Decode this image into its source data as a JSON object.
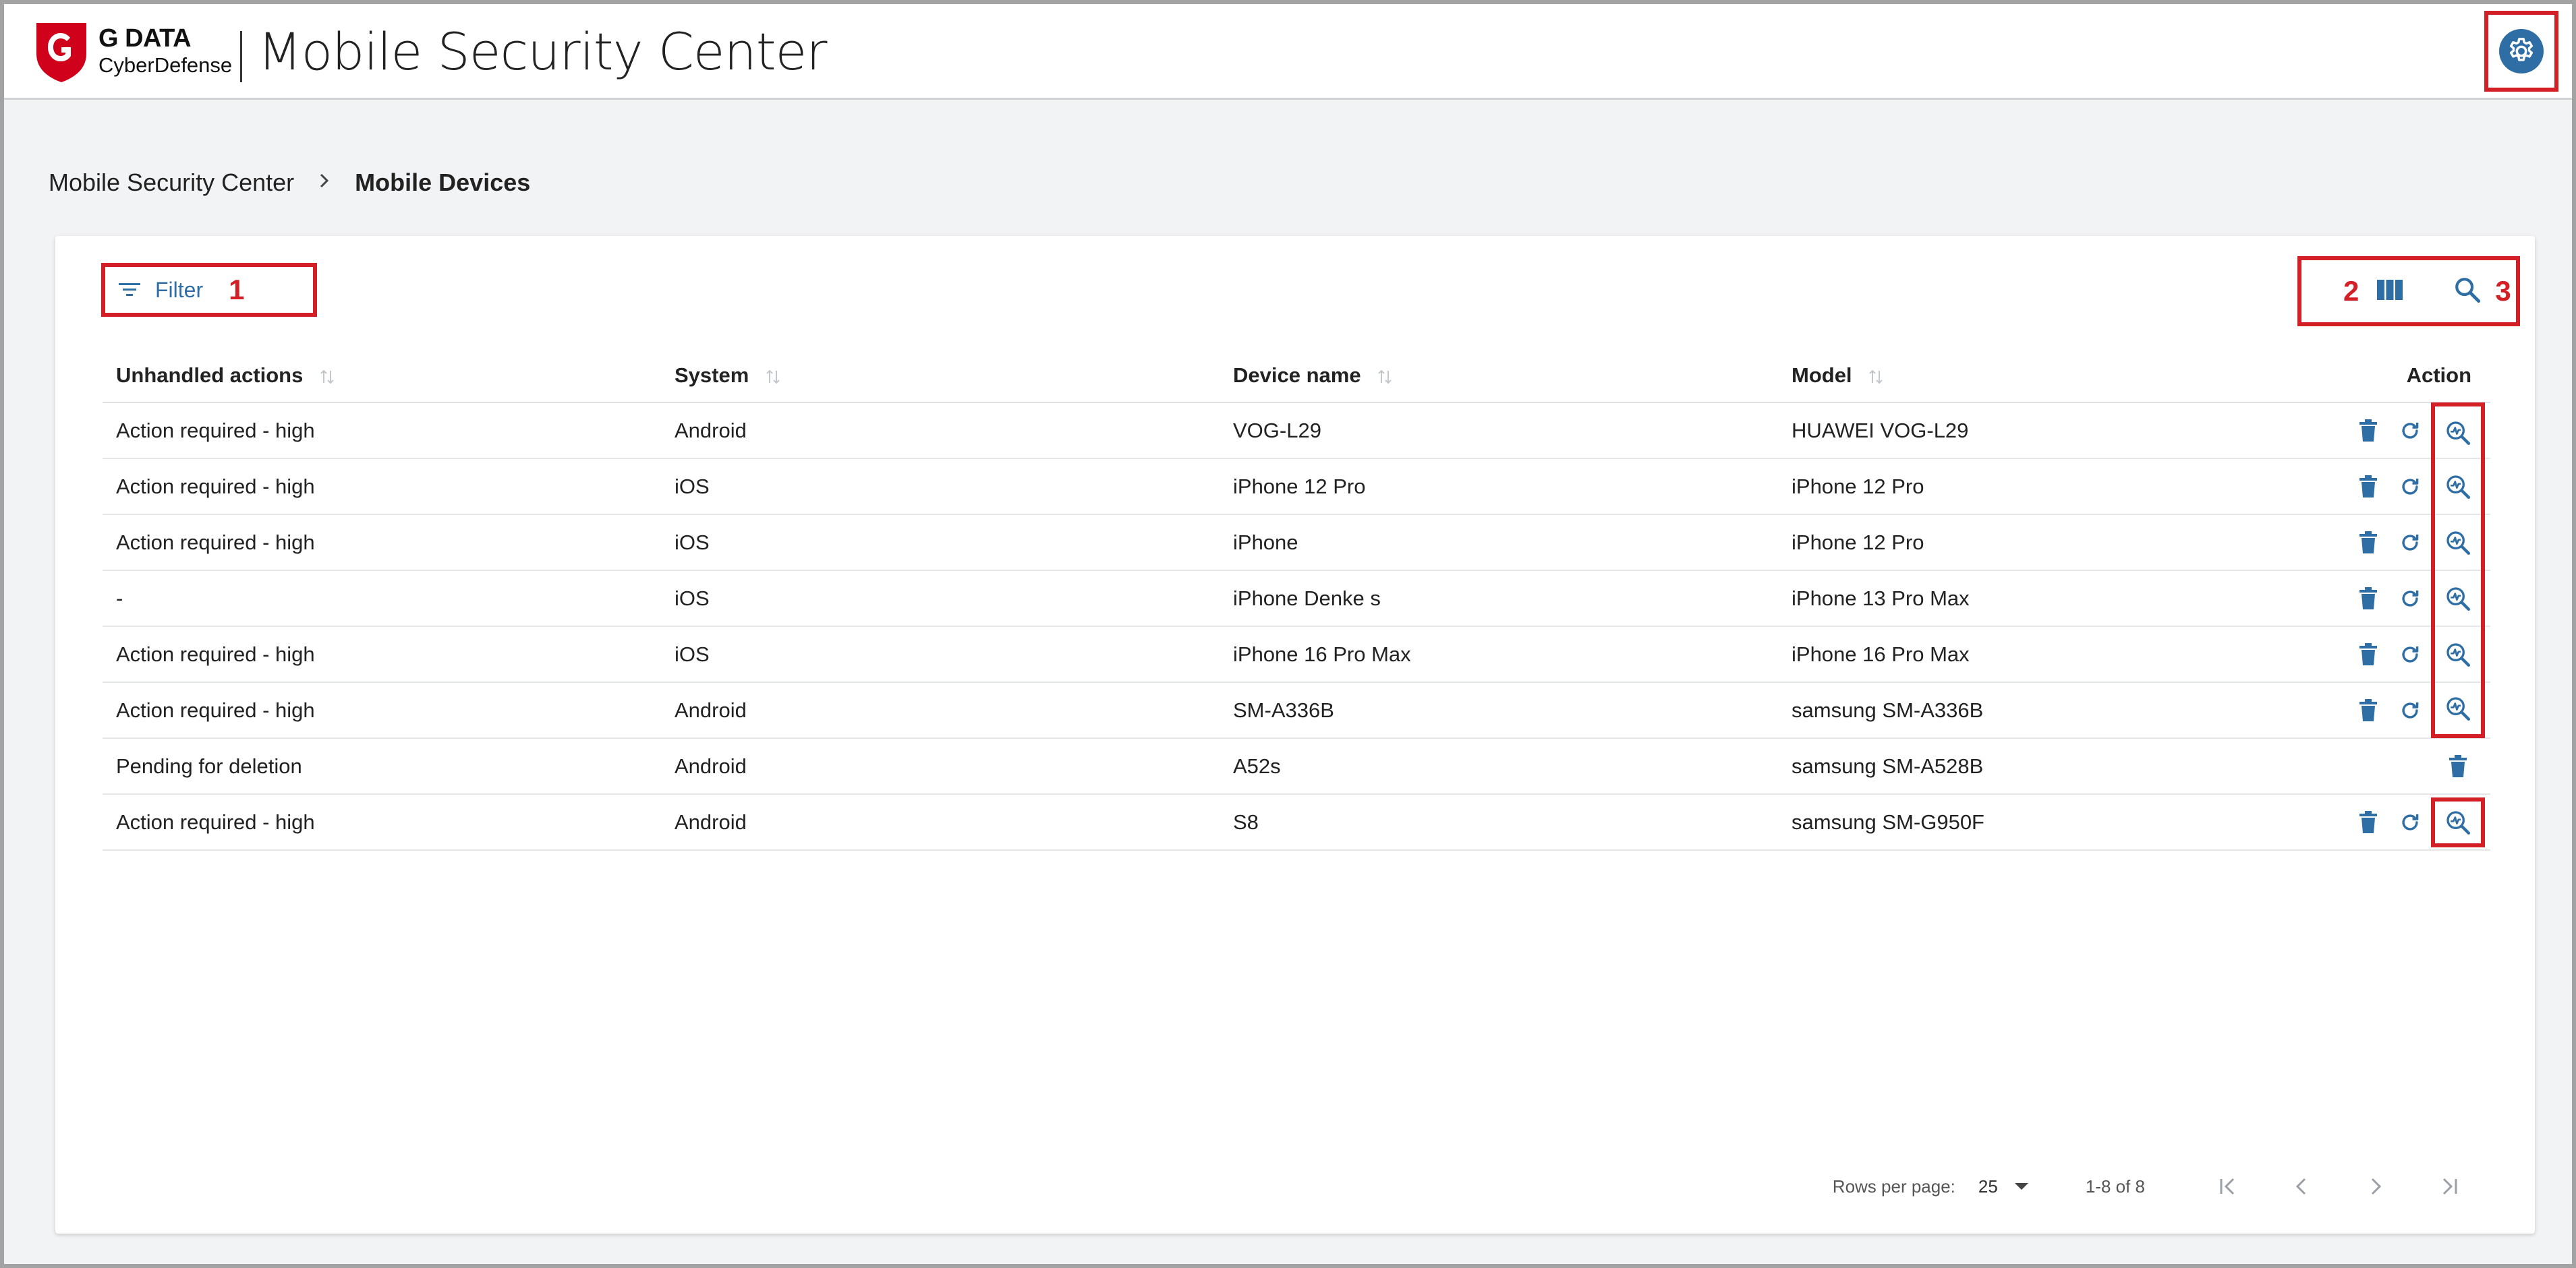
{
  "header": {
    "brand_line1": "G DATA",
    "brand_line2": "CyberDefense",
    "app_title": "Mobile Security Center"
  },
  "colors": {
    "accent": "#2e6ea5",
    "annotation": "#d32027",
    "brand_red": "#d0021b"
  },
  "breadcrumb": {
    "items": [
      "Mobile Security Center",
      "Mobile Devices"
    ]
  },
  "toolbar": {
    "filter_label": "Filter",
    "marker_filter": "1",
    "marker_columns": "2",
    "marker_search": "3"
  },
  "table": {
    "columns": [
      "Unhandled actions",
      "System",
      "Device name",
      "Model",
      "Action"
    ],
    "rows": [
      {
        "unhandled": "Action required - high",
        "system": "Android",
        "device": "VOG-L29",
        "model": "HUAWEI VOG-L29",
        "actions": [
          "delete",
          "refresh",
          "scan"
        ]
      },
      {
        "unhandled": "Action required - high",
        "system": "iOS",
        "device": "iPhone 12 Pro",
        "model": "iPhone 12 Pro",
        "actions": [
          "delete",
          "refresh",
          "scan"
        ]
      },
      {
        "unhandled": "Action required - high",
        "system": "iOS",
        "device": "iPhone",
        "model": "iPhone 12 Pro",
        "actions": [
          "delete",
          "refresh",
          "scan"
        ]
      },
      {
        "unhandled": "-",
        "system": "iOS",
        "device": "iPhone Denke s",
        "model": "iPhone 13 Pro Max",
        "actions": [
          "delete",
          "refresh",
          "scan"
        ]
      },
      {
        "unhandled": "Action required - high",
        "system": "iOS",
        "device": "iPhone 16 Pro Max",
        "model": "iPhone 16 Pro Max",
        "actions": [
          "delete",
          "refresh",
          "scan"
        ]
      },
      {
        "unhandled": "Action required - high",
        "system": "Android",
        "device": "SM-A336B",
        "model": "samsung SM-A336B",
        "actions": [
          "delete",
          "refresh",
          "scan"
        ]
      },
      {
        "unhandled": "Pending for deletion",
        "system": "Android",
        "device": "A52s",
        "model": "samsung SM-A528B",
        "actions": [
          "delete"
        ]
      },
      {
        "unhandled": "Action required - high",
        "system": "Android",
        "device": "S8",
        "model": "samsung SM-G950F",
        "actions": [
          "delete",
          "refresh",
          "scan"
        ]
      }
    ]
  },
  "pagination": {
    "rows_per_page_label": "Rows per page:",
    "rows_per_page_value": "25",
    "range_label": "1-8 of 8"
  },
  "icons": {
    "settings": "gear-icon",
    "filter": "filter-icon",
    "columns": "columns-icon",
    "search": "search-icon",
    "delete": "trash-icon",
    "refresh": "refresh-icon",
    "scan": "scan-search-icon"
  }
}
